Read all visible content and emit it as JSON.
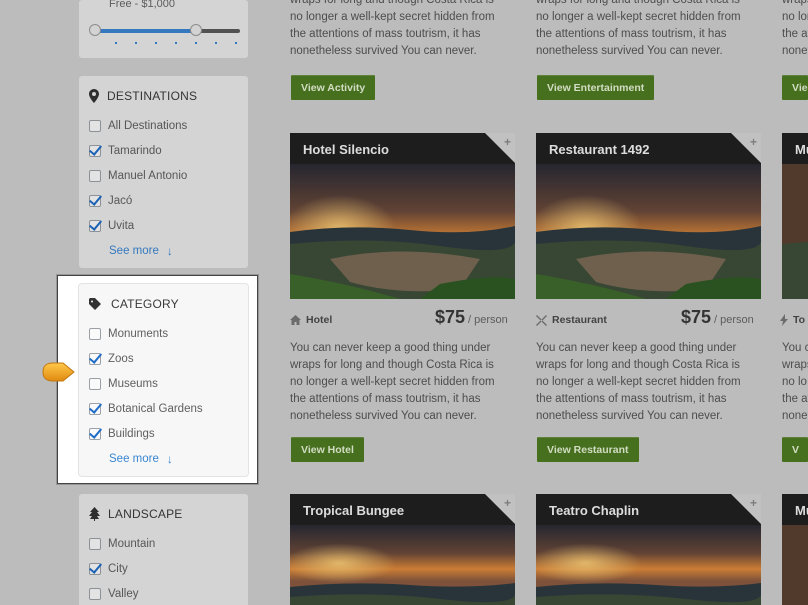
{
  "price_filter": {
    "range_label": "Free - $1,000",
    "range_min_fraction": 0.0,
    "range_max_fraction": 0.7
  },
  "destinations": {
    "title": "DESTINATIONS",
    "options": [
      {
        "label": "All Destinations",
        "checked": false
      },
      {
        "label": "Tamarindo",
        "checked": true
      },
      {
        "label": "Manuel Antonio",
        "checked": false
      },
      {
        "label": "Jacó",
        "checked": true
      },
      {
        "label": "Uvita",
        "checked": true
      }
    ],
    "see_more": "See more",
    "arrow": "↓"
  },
  "category": {
    "title": "CATEGORY",
    "options": [
      {
        "label": "Monuments",
        "checked": false
      },
      {
        "label": "Zoos",
        "checked": true
      },
      {
        "label": "Museums",
        "checked": false
      },
      {
        "label": "Botanical Gardens",
        "checked": true
      },
      {
        "label": "Buildings",
        "checked": true
      }
    ],
    "see_more": "See more",
    "arrow": "↓"
  },
  "landscape": {
    "title": "LANDSCAPE",
    "options": [
      {
        "label": "Mountain",
        "checked": false
      },
      {
        "label": "City",
        "checked": true
      },
      {
        "label": "Valley",
        "checked": false
      }
    ]
  },
  "description_lines": [
    "wraps for long and though Costa Rica is",
    "no longer a well-kept secret hidden from",
    "the attentions of mass toutrism, it has",
    "nonetheless survived You can never."
  ],
  "full_description_lines": [
    "You can never keep a good thing under",
    "wraps for long and though Costa Rica is",
    "no longer a well-kept secret hidden from",
    "the attentions of mass toutrism, it has",
    "nonetheless survived You can never."
  ],
  "top_buttons": [
    "View Activity",
    "View Entertainment",
    "Vie"
  ],
  "cards": [
    {
      "title": "Hotel Silencio",
      "type": "Hotel",
      "price": "$75",
      "per": "/ person",
      "button": "View Hotel"
    },
    {
      "title": "Restaurant 1492",
      "type": "Restaurant",
      "price": "$75",
      "per": "/ person",
      "button": "View Restaurant"
    },
    {
      "title": "Mu",
      "type": "To",
      "desc_prefix": [
        "You c",
        "wraps",
        "no lo",
        "the at",
        "nonet"
      ],
      "button": "V"
    }
  ],
  "bottom_cards": [
    {
      "title": "Tropical Bungee"
    },
    {
      "title": "Teatro Chaplin"
    },
    {
      "title": "Mu"
    }
  ],
  "plus_glyph": "+",
  "colors": {
    "button_green": "#4e7b22",
    "check_blue": "#1e6cc8",
    "link_blue": "#3a86d2",
    "pointer_orange": "#f0a417"
  }
}
